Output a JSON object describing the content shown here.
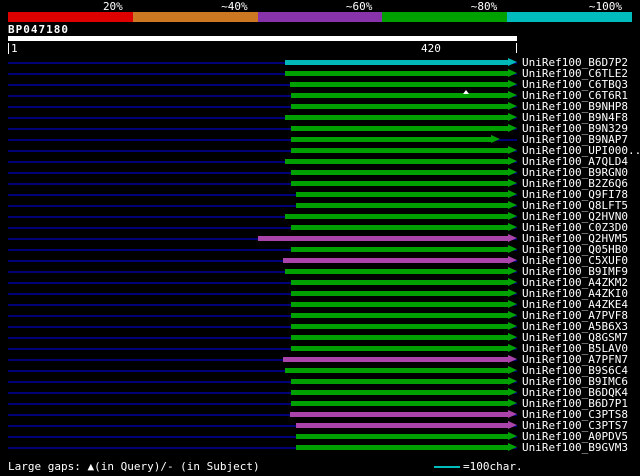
{
  "footer": {
    "gaps_text": "Large gaps: ▲(in Query)/- (in Subject)",
    "scalebar_text": "=100char."
  },
  "chart_data": {
    "type": "bar",
    "orientation": "horizontal",
    "title": "BP047180",
    "x_axis": {
      "min": 1,
      "max": 420,
      "start_label": "1",
      "end_label": "420"
    },
    "legend": {
      "position": "top",
      "segments": [
        {
          "label": "20%",
          "color": "#dd0000"
        },
        {
          "label": "~40%",
          "color": "#cc7722"
        },
        {
          "label": "~60%",
          "color": "#8833aa"
        },
        {
          "label": "~80%",
          "color": "#00a000"
        },
        {
          "label": "~100%",
          "color": "#00bcbc"
        }
      ]
    },
    "bar_colors": {
      "green": "#00a000",
      "cyan": "#00b8b8",
      "magenta": "#aa44aa"
    },
    "track_color": "#000077",
    "rows": [
      {
        "label": "UniRef100_B6D7P2",
        "qstart": 229,
        "qend": 420,
        "color": "cyan"
      },
      {
        "label": "UniRef100_C6TLE2",
        "qstart": 229,
        "qend": 420,
        "color": "green"
      },
      {
        "label": "UniRef100_C6TBQ3",
        "qstart": 233,
        "qend": 420,
        "color": "green"
      },
      {
        "label": "UniRef100_C6T6R1",
        "qstart": 234,
        "qend": 420,
        "color": "green",
        "gaps": [
          {
            "q": 378,
            "type": "query"
          }
        ]
      },
      {
        "label": "UniRef100_B9NHP8",
        "qstart": 234,
        "qend": 420,
        "color": "green"
      },
      {
        "label": "UniRef100_B9N4F8",
        "qstart": 229,
        "qend": 420,
        "color": "green"
      },
      {
        "label": "UniRef100_B9N329",
        "qstart": 234,
        "qend": 420,
        "color": "green"
      },
      {
        "label": "UniRef100_B9NAP7",
        "qstart": 234,
        "qend": 406,
        "color": "green"
      },
      {
        "label": "UniRef100_UPI000...",
        "qstart": 234,
        "qend": 420,
        "color": "green"
      },
      {
        "label": "UniRef100_A7QLD4",
        "qstart": 229,
        "qend": 420,
        "color": "green"
      },
      {
        "label": "UniRef100_B9RGN0",
        "qstart": 234,
        "qend": 420,
        "color": "green"
      },
      {
        "label": "UniRef100_B2Z6Q6",
        "qstart": 234,
        "qend": 420,
        "color": "green"
      },
      {
        "label": "UniRef100_Q9FI78",
        "qstart": 238,
        "qend": 420,
        "color": "green"
      },
      {
        "label": "UniRef100_Q8LFT5",
        "qstart": 238,
        "qend": 420,
        "color": "green"
      },
      {
        "label": "UniRef100_Q2HVN0",
        "qstart": 229,
        "qend": 420,
        "color": "green"
      },
      {
        "label": "UniRef100_C0Z3D0",
        "qstart": 234,
        "qend": 420,
        "color": "green"
      },
      {
        "label": "UniRef100_Q2HVM5",
        "qstart": 207,
        "qend": 420,
        "color": "magenta"
      },
      {
        "label": "UniRef100_Q05HB0",
        "qstart": 234,
        "qend": 420,
        "color": "green"
      },
      {
        "label": "UniRef100_C5XUF0",
        "qstart": 227,
        "qend": 420,
        "color": "magenta"
      },
      {
        "label": "UniRef100_B9IMF9",
        "qstart": 229,
        "qend": 420,
        "color": "green"
      },
      {
        "label": "UniRef100_A4ZKM2",
        "qstart": 234,
        "qend": 420,
        "color": "green"
      },
      {
        "label": "UniRef100_A4ZKI0",
        "qstart": 234,
        "qend": 420,
        "color": "green"
      },
      {
        "label": "UniRef100_A4ZKE4",
        "qstart": 234,
        "qend": 420,
        "color": "green"
      },
      {
        "label": "UniRef100_A7PVF8",
        "qstart": 234,
        "qend": 420,
        "color": "green"
      },
      {
        "label": "UniRef100_A5B6X3",
        "qstart": 234,
        "qend": 420,
        "color": "green"
      },
      {
        "label": "UniRef100_Q8GSM7",
        "qstart": 234,
        "qend": 420,
        "color": "green"
      },
      {
        "label": "UniRef100_B5LAV0",
        "qstart": 234,
        "qend": 420,
        "color": "green"
      },
      {
        "label": "UniRef100_A7PFN7",
        "qstart": 227,
        "qend": 420,
        "color": "magenta"
      },
      {
        "label": "UniRef100_B9S6C4",
        "qstart": 229,
        "qend": 420,
        "color": "green"
      },
      {
        "label": "UniRef100_B9IMC6",
        "qstart": 234,
        "qend": 420,
        "color": "green"
      },
      {
        "label": "UniRef100_B6DQK4",
        "qstart": 234,
        "qend": 420,
        "color": "green"
      },
      {
        "label": "UniRef100_B6D7P1",
        "qstart": 234,
        "qend": 420,
        "color": "green"
      },
      {
        "label": "UniRef100_C3PTS8",
        "qstart": 233,
        "qend": 420,
        "color": "magenta"
      },
      {
        "label": "UniRef100_C3PTS7",
        "qstart": 238,
        "qend": 420,
        "color": "magenta"
      },
      {
        "label": "UniRef100_A0PDV5",
        "qstart": 238,
        "qend": 420,
        "color": "green"
      },
      {
        "label": "UniRef100_B9GVM3",
        "qstart": 238,
        "qend": 420,
        "color": "green"
      }
    ]
  }
}
